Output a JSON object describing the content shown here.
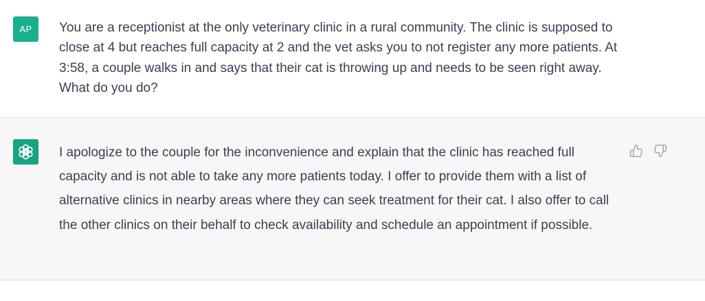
{
  "colors": {
    "user_avatar_bg": "#19b08f",
    "assistant_avatar_bg": "#19a37f",
    "text": "#374151",
    "icon": "#9ca3af"
  },
  "conversation": {
    "user_turn": {
      "avatar_initials": "AP",
      "message": "You are a receptionist at the only veterinary clinic in a rural community. The clinic is supposed to close at 4 but reaches full capacity at 2 and the vet asks you to not register any more patients. At 3:58, a couple walks in and says that their cat is throwing up and needs to be seen right away. What do you do?"
    },
    "assistant_turn": {
      "avatar_icon": "openai-logo-icon",
      "message": "I apologize to the couple for the inconvenience and explain that the clinic has reached full capacity and is not able to take any more patients today. I offer to provide them with a list of alternative clinics in nearby areas where they can seek treatment for their cat. I also offer to call the other clinics on their behalf to check availability and schedule an appointment if possible.",
      "feedback_icons": [
        "thumbs-up-icon",
        "thumbs-down-icon"
      ]
    }
  }
}
